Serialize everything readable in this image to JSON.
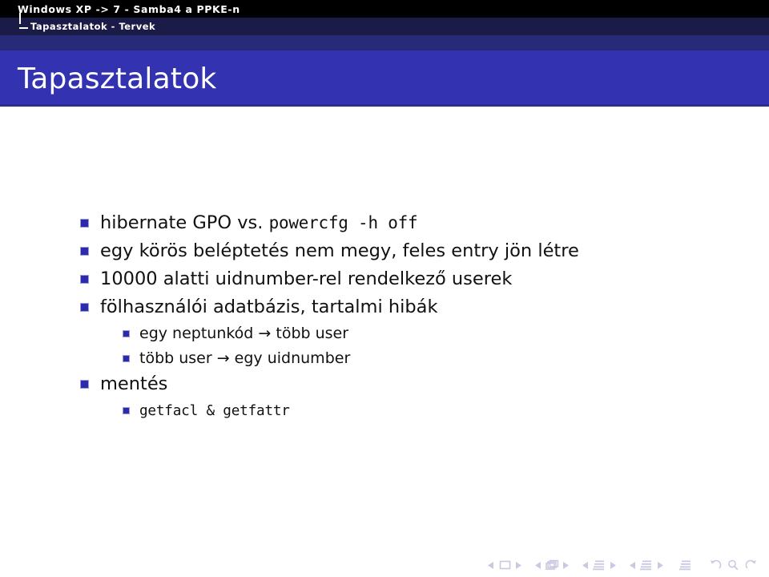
{
  "header": {
    "presentation_title": "Windows XP -> 7 - Samba4 a PPKE-n",
    "section_title": "Tapasztalatok - Tervek",
    "tree_icon": "tree-branch-icon"
  },
  "slide": {
    "frame_title": "Tapasztalatok",
    "items": [
      {
        "level": 1,
        "marker": "square-bullet",
        "parts": [
          {
            "text": "hibernate GPO vs. ",
            "style": "normal"
          },
          {
            "text": "powercfg -h off",
            "style": "mono"
          }
        ],
        "plain": "hibernate GPO vs. powercfg -h off"
      },
      {
        "level": 1,
        "marker": "square-bullet",
        "parts": [
          {
            "text": "egy körös beléptetés nem megy, feles entry jön létre",
            "style": "normal"
          }
        ],
        "plain": "egy körös beléptetés nem megy, feles entry jön létre"
      },
      {
        "level": 1,
        "marker": "square-bullet",
        "parts": [
          {
            "text": "10000 alatti uidnumber-rel rendelkező userek",
            "style": "normal"
          }
        ],
        "plain": "10000 alatti uidnumber-rel rendelkező userek"
      },
      {
        "level": 1,
        "marker": "square-bullet",
        "parts": [
          {
            "text": "fölhasználói adatbázis, tartalmi hibák",
            "style": "normal"
          }
        ],
        "plain": "fölhasználói adatbázis, tartalmi hibák"
      },
      {
        "level": 2,
        "marker": "square-bullet",
        "parts": [
          {
            "text": "egy neptunkód ",
            "style": "normal"
          },
          {
            "text": "→",
            "style": "arrow"
          },
          {
            "text": " több user",
            "style": "normal"
          }
        ],
        "plain": "egy neptunkód → több user"
      },
      {
        "level": 2,
        "marker": "square-bullet",
        "parts": [
          {
            "text": "több user ",
            "style": "normal"
          },
          {
            "text": "→",
            "style": "arrow"
          },
          {
            "text": " egy uidnumber",
            "style": "normal"
          }
        ],
        "plain": "több user → egy uidnumber"
      },
      {
        "level": 1,
        "marker": "square-bullet",
        "parts": [
          {
            "text": "mentés",
            "style": "normal"
          }
        ],
        "plain": "mentés"
      },
      {
        "level": 2,
        "marker": "square-bullet",
        "parts": [
          {
            "text": "getfacl & getfattr",
            "style": "mono"
          }
        ],
        "plain": "getfacl & getfattr"
      }
    ]
  },
  "navigation": {
    "groups": [
      {
        "name": "slide",
        "icon": "slide-icon",
        "has_arrows": true
      },
      {
        "name": "frame",
        "icon": "frames-stack-icon",
        "has_arrows": true
      },
      {
        "name": "subsection",
        "icon": "subsection-lines-icon",
        "has_arrows": true
      },
      {
        "name": "section",
        "icon": "section-lines-icon",
        "has_arrows": true
      },
      {
        "name": "presentation",
        "icon": "document-lines-icon",
        "has_arrows": false
      }
    ],
    "extra": [
      {
        "name": "back",
        "icon": "undo-arrow-icon"
      },
      {
        "name": "find",
        "icon": "search-icon"
      },
      {
        "name": "forward",
        "icon": "redo-arrow-icon"
      }
    ]
  },
  "colors": {
    "title_bar": "#000000",
    "section_bar": "#1b1b47",
    "subsection_bar": "#272a78",
    "banner": "#3333b2",
    "bullet": "#2b2bab",
    "body_text": "#111111",
    "nav": "#c9c9e2"
  }
}
